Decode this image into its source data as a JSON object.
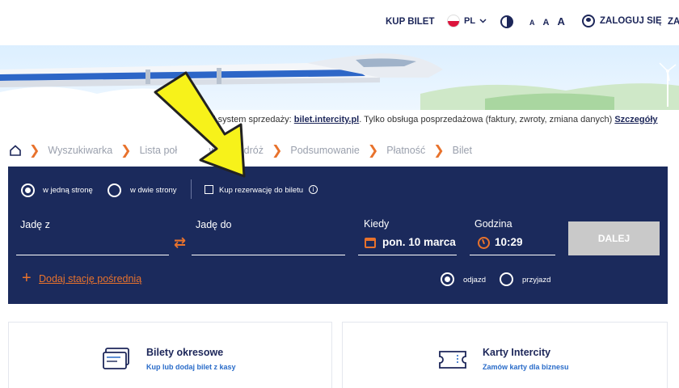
{
  "header": {
    "buy_ticket": "KUP BILET",
    "language": "PL",
    "font_sizes": [
      "A",
      "A",
      "A"
    ],
    "login": "ZALOGUJ SIĘ",
    "register_partial": "ZA"
  },
  "notice": {
    "prefix": "ai system sprzedaży: ",
    "site": "bilet.intercity.pl",
    "middle": ". Tylko obsługa posprzedażowa (faktury, zwroty, zmiana danych) ",
    "details_link": "Szczegóły"
  },
  "breadcrumb": [
    "Wyszukiwarka",
    "Lista poł",
    "woja podróż",
    "Podsumowanie",
    "Płatność",
    "Bilet"
  ],
  "search": {
    "one_way": "w jedną stronę",
    "two_way": "w dwie strony",
    "reservation_checkbox": "Kup rezerwację do biletu",
    "from_label": "Jadę z",
    "to_label": "Jadę do",
    "when_label": "Kiedy",
    "when_value": "pon. 10 marca",
    "time_label": "Godzina",
    "time_value": "10:29",
    "next_button": "DALEJ",
    "add_station": "Dodaj stację pośrednią",
    "departure": "odjazd",
    "arrival": "przyjazd"
  },
  "cards": [
    {
      "title": "Bilety okresowe",
      "subtitle": "Kup lub dodaj bilet z kasy"
    },
    {
      "title": "Karty Intercity",
      "subtitle": "Zamów karty dla biznesu"
    }
  ],
  "colors": {
    "navy": "#1b2a5c",
    "accent_orange": "#e8722c",
    "overlay_arrow": "#f7f21a"
  }
}
